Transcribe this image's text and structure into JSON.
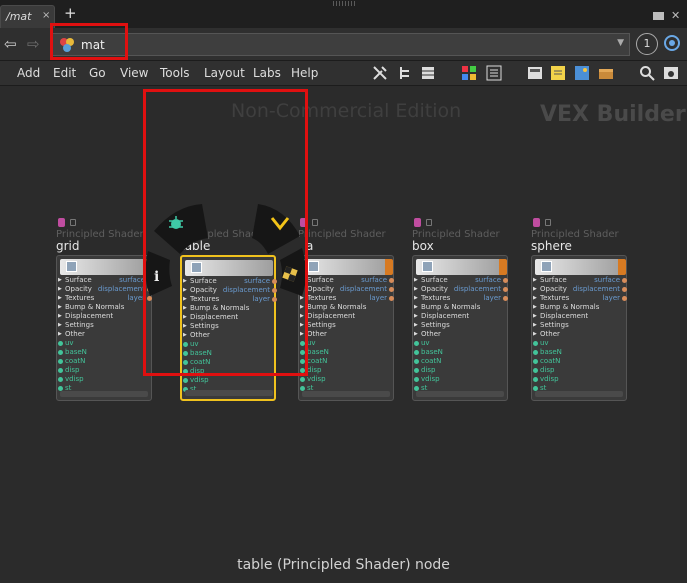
{
  "tabbar": {
    "tab_label": "/mat",
    "close": "×",
    "add": "+"
  },
  "pathbar": {
    "path": "mat",
    "pin": "1"
  },
  "menu": [
    "Add",
    "Edit",
    "Go",
    "View",
    "Tools",
    "Layout",
    "Labs",
    "Help"
  ],
  "toolbar_icons": [
    "wrench-icon",
    "tree-icon",
    "list-icon",
    "grid-icon",
    "layout-icon",
    "note-icon",
    "image-icon",
    "box-icon",
    "search-icon",
    "eye-icon"
  ],
  "network": {
    "watermark": "Non-Commercial Edition",
    "context": "VEX Builder",
    "status": "table (Principled Shader) node"
  },
  "nodes": [
    {
      "type": "Principled Shader",
      "name": "grid"
    },
    {
      "type": "Principled Shader",
      "name": "table"
    },
    {
      "type": "Principled Shader",
      "name": "a"
    },
    {
      "type": "Principled Shader",
      "name": "box"
    },
    {
      "type": "Principled Shader",
      "name": "sphere"
    }
  ],
  "node_inputs": [
    "Surface",
    "Opacity",
    "Textures",
    "Bump & Normals",
    "Displacement",
    "Settings",
    "Other"
  ],
  "node_outputs": [
    "surface",
    "displacement",
    "layer"
  ],
  "node_subinputs": [
    "uv",
    "baseN",
    "coatN",
    "disp",
    "vdisp",
    "st"
  ],
  "colors": {
    "highlight": "#e01010",
    "selected": "#f0c21e",
    "accent": "#d77a22"
  }
}
